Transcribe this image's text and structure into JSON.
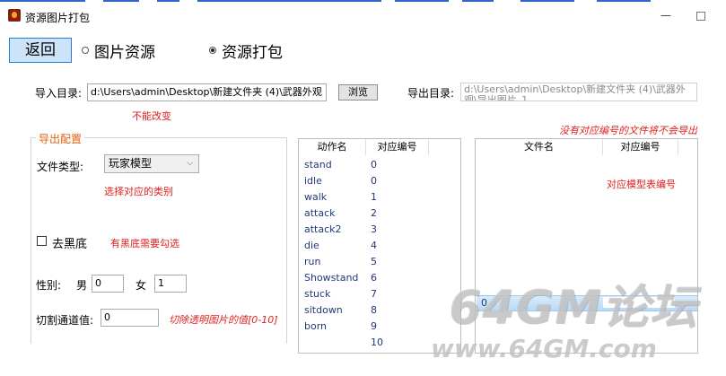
{
  "window": {
    "title": "资源图片打包",
    "minimize_glyph": "—"
  },
  "toolbar": {
    "back_label": "返回",
    "radio_images_label": "图片资源",
    "radio_pack_label": "资源打包"
  },
  "import": {
    "label": "导入目录:",
    "value": "d:\\Users\\admin\\Desktop\\新建文件夹 (4)\\武器外观",
    "browse_label": "浏览",
    "note": "不能改变"
  },
  "export": {
    "label": "导出目录:",
    "value": "d:\\Users\\admin\\Desktop\\新建文件夹 (4)\\武器外观\\导出图片_1"
  },
  "config": {
    "legend": "导出配置",
    "file_type_label": "文件类型:",
    "file_type_value": "玩家模型",
    "file_type_note": "选择对应的类别",
    "remove_black_label": "去黑底",
    "remove_black_note": "有黑底需要勾选",
    "gender_label": "性别:",
    "male_label": "男",
    "male_value": "0",
    "female_label": "女",
    "female_value": "1",
    "threshold_label": "切割通道值:",
    "threshold_value": "0",
    "threshold_note": "切除透明图片的值[0-10]"
  },
  "actions_list": {
    "headers": [
      "动作名",
      "对应编号"
    ],
    "rows": [
      [
        "stand",
        "0"
      ],
      [
        "idle",
        "0"
      ],
      [
        "walk",
        "1"
      ],
      [
        "attack",
        "2"
      ],
      [
        "attack2",
        "3"
      ],
      [
        "die",
        "4"
      ],
      [
        "run",
        "5"
      ],
      [
        "Showstand",
        "6"
      ],
      [
        "stuck",
        "7"
      ],
      [
        "sitdown",
        "8"
      ],
      [
        "born",
        "9"
      ],
      [
        "",
        "10"
      ]
    ]
  },
  "files_list": {
    "warning": "没有对应编号的文件将不会导出",
    "headers": [
      "文件名",
      "对应编号"
    ],
    "rows": [
      [
        "0",
        ""
      ]
    ],
    "note": "对应模型表编号"
  },
  "watermark": {
    "main": "64GM论坛",
    "url": "www.64GM.com"
  },
  "colors": {
    "accent_blue": "#2a7ad4",
    "note_red": "#e02020",
    "legend_orange": "#e0620a"
  }
}
